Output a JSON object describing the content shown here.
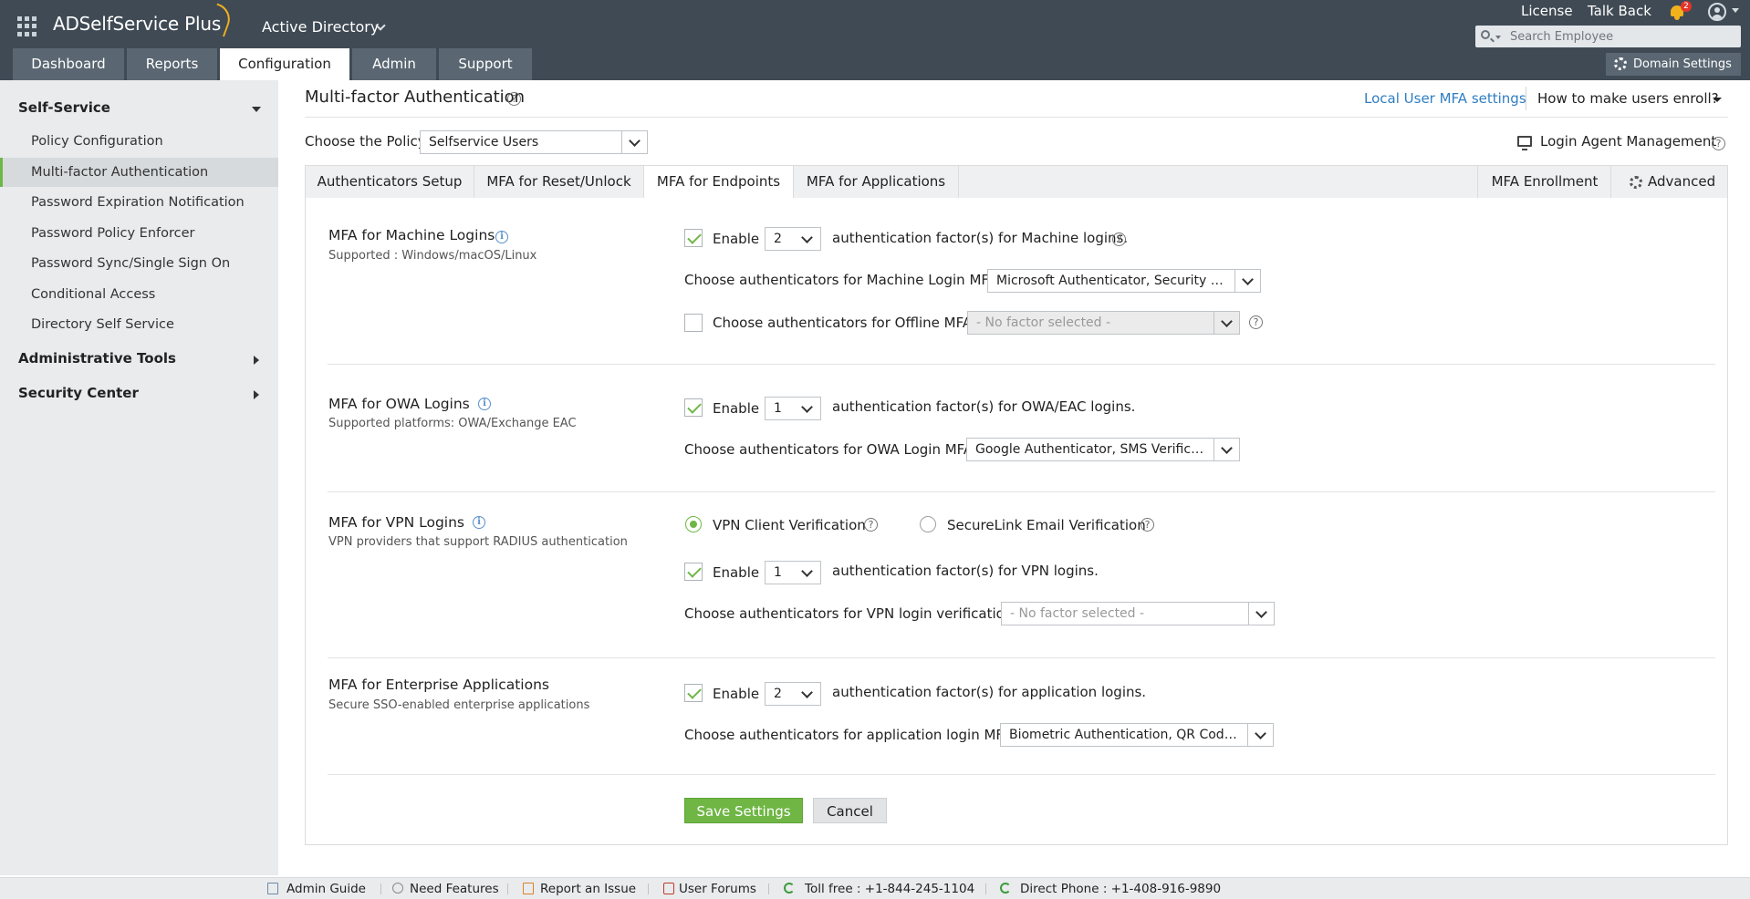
{
  "header": {
    "brand": "ADSelfService Plus",
    "product": "Active Directory",
    "links": {
      "license": "License",
      "talk_back": "Talk Back"
    },
    "notification_count": "2",
    "search_placeholder": "Search Employee",
    "domain_settings": "Domain Settings",
    "nav": [
      "Dashboard",
      "Reports",
      "Configuration",
      "Admin",
      "Support"
    ],
    "active_nav": "Configuration",
    "colors": {
      "topbar": "#3f4a54",
      "accent": "#6fb645",
      "link": "#2f7ec2"
    }
  },
  "sidebar": {
    "self_service": "Self-Service",
    "items": [
      "Policy Configuration",
      "Multi-factor Authentication",
      "Password Expiration Notification",
      "Password Policy Enforcer",
      "Password Sync/Single Sign On",
      "Conditional Access",
      "Directory Self Service"
    ],
    "active_item": "Multi-factor Authentication",
    "admin_tools": "Administrative Tools",
    "security_center": "Security Center"
  },
  "main": {
    "title": "Multi-factor Authentication",
    "local_user_link": "Local User MFA settings",
    "how_to_enroll": "How to make users enroll?",
    "policy_label": "Choose the Policy",
    "policy_value": "Selfservice Users",
    "login_agent": "Login Agent Management",
    "tabs": [
      "Authenticators Setup",
      "MFA for Reset/Unlock",
      "MFA for Endpoints",
      "MFA for Applications"
    ],
    "active_tab": "MFA for Endpoints",
    "right_tabs": {
      "enrollment": "MFA Enrollment",
      "advanced": "Advanced"
    }
  },
  "sections": {
    "machine": {
      "title": "MFA for Machine Logins",
      "subtitle": "Supported : Windows/macOS/Linux",
      "enable_label": "Enable",
      "enabled": true,
      "factors": "2",
      "factor_text": "authentication factor(s) for Machine logins.",
      "choose_label": "Choose authenticators for Machine Login MFA",
      "choose_value": "Microsoft Authenticator, Security Q...",
      "offline_label": "Choose authenticators for Offline MFA",
      "offline_checked": false,
      "offline_value": "- No factor selected -"
    },
    "owa": {
      "title": "MFA for OWA Logins",
      "subtitle": "Supported platforms: OWA/Exchange EAC",
      "enable_label": "Enable",
      "enabled": true,
      "factors": "1",
      "factor_text": "authentication factor(s) for OWA/EAC logins.",
      "choose_label": "Choose authenticators for OWA Login MFA",
      "choose_value": "Google Authenticator, SMS Verificat..."
    },
    "vpn": {
      "title": "MFA for VPN Logins",
      "subtitle": "VPN providers that support RADIUS authentication",
      "radio_client": "VPN Client Verification",
      "radio_securelink": "SecureLink Email Verification",
      "selected_radio": "VPN Client Verification",
      "enable_label": "Enable",
      "enabled": true,
      "factors": "1",
      "factor_text": "authentication factor(s) for VPN logins.",
      "choose_label": "Choose authenticators for VPN login verification",
      "choose_value": "- No factor selected -"
    },
    "enterprise": {
      "title": "MFA for Enterprise Applications",
      "subtitle": "Secure SSO-enabled enterprise applications",
      "enable_label": "Enable",
      "enabled": true,
      "factors": "2",
      "factor_text": "authentication factor(s) for application logins.",
      "choose_label": "Choose authenticators for application login MFA",
      "choose_value": "Biometric Authentication, QR Code ..."
    }
  },
  "actions": {
    "save": "Save Settings",
    "cancel": "Cancel"
  },
  "footer": {
    "admin_guide": "Admin Guide",
    "need_features": "Need Features",
    "report_issue": "Report an Issue",
    "user_forums": "User Forums",
    "toll_free": "Toll free : +1-844-245-1104",
    "direct_phone": "Direct Phone : +1-408-916-9890"
  }
}
